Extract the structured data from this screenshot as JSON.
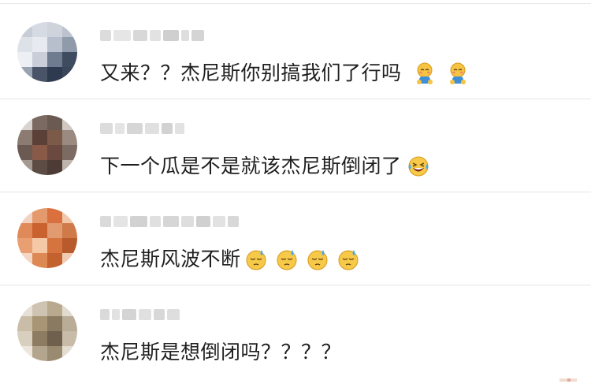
{
  "comments": [
    {
      "text": "又来？？杰尼斯你别搞我们了行吗",
      "emoji": "shy-sitting-emoji"
    },
    {
      "text": "下一个瓜是不是就该杰尼斯倒闭了",
      "emoji": "laughing-crying-emoji"
    },
    {
      "text": "杰尼斯风波不断",
      "emoji": "sweat-face-emoji"
    },
    {
      "text": "杰尼斯是想倒闭吗？？？？",
      "emoji": ""
    }
  ]
}
